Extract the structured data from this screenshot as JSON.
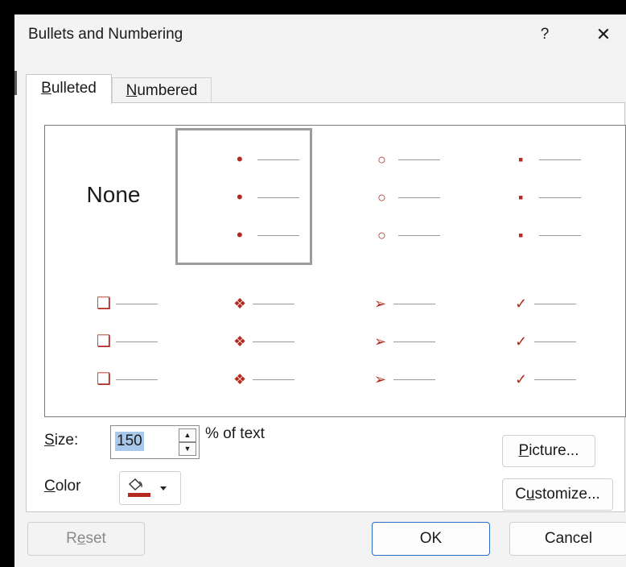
{
  "window": {
    "title": "Bullets and Numbering",
    "help_label": "?",
    "close_label": "✕"
  },
  "tabs": [
    {
      "prefix": "",
      "key": "B",
      "rest": "ulleted",
      "selected": true
    },
    {
      "prefix": "",
      "key": "N",
      "rest": "umbered",
      "selected": false
    }
  ],
  "gallery": {
    "none_label": "None",
    "bullet_color": "#b22b1e",
    "selected_index": 1,
    "styles": [
      {
        "icon": "none"
      },
      {
        "icon": "filled-dot-bullet",
        "glyph": "•"
      },
      {
        "icon": "hollow-circle-bullet",
        "glyph": "○"
      },
      {
        "icon": "filled-square-bullet",
        "glyph": "▪"
      },
      {
        "icon": "hollow-square-bullet",
        "glyph": "❑"
      },
      {
        "icon": "four-diamond-bullet",
        "glyph": "❖"
      },
      {
        "icon": "arrowhead-bullet",
        "glyph": "➢"
      },
      {
        "icon": "checkmark-bullet",
        "glyph": "✓"
      }
    ]
  },
  "size": {
    "label_key": "S",
    "label_rest": "ize:",
    "value": "150",
    "suffix": "% of text"
  },
  "color": {
    "label_key": "C",
    "label_rest": "olor",
    "swatch": "#b22b1e",
    "icon": "paint-bucket-icon"
  },
  "buttons": {
    "picture": {
      "key": "P",
      "rest": "icture..."
    },
    "customize": {
      "pre": "C",
      "key": "u",
      "rest": "stomize..."
    },
    "reset": {
      "pre": "R",
      "key": "e",
      "rest": "set"
    },
    "ok": "OK",
    "cancel": "Cancel"
  }
}
